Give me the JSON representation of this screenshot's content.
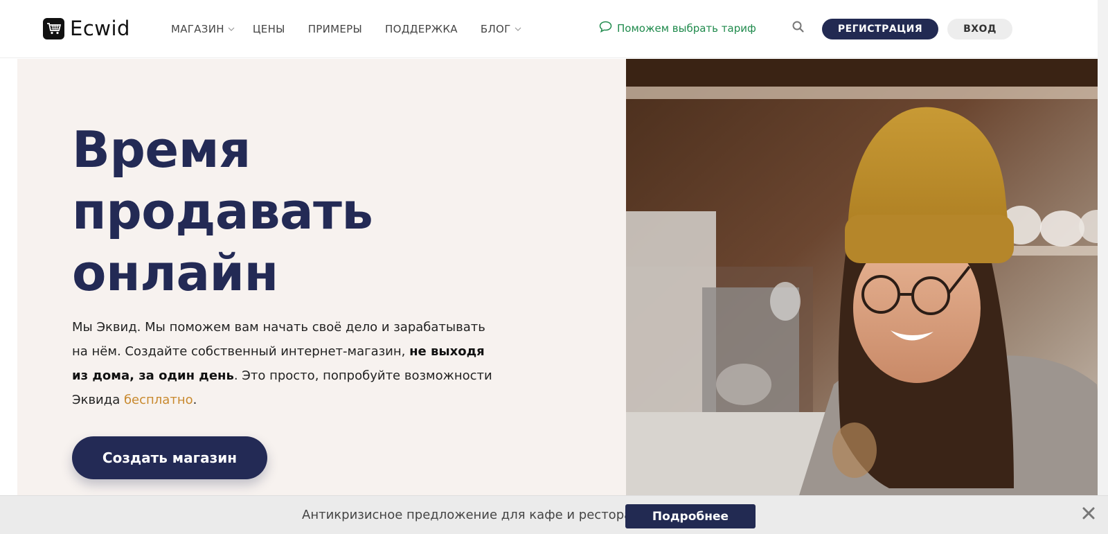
{
  "header": {
    "logo_text": "Ecwid",
    "nav": [
      {
        "label": "МАГАЗИН",
        "has_dropdown": true
      },
      {
        "label": "ЦЕНЫ",
        "has_dropdown": false
      },
      {
        "label": "ПРИМЕРЫ",
        "has_dropdown": false
      },
      {
        "label": "ПОДДЕРЖКА",
        "has_dropdown": false
      },
      {
        "label": "БЛОГ",
        "has_dropdown": true
      }
    ],
    "help_link": "Поможем выбрать тариф",
    "register_label": "РЕГИСТРАЦИЯ",
    "login_label": "ВХОД"
  },
  "hero": {
    "title": "Время\nпродавать\nонлайн",
    "text_part1": "Мы Эквид. Мы поможем вам начать своё дело и зарабатывать на нём. Создайте собственный интернет-магазин, ",
    "text_bold": "не выходя из дома, за один день",
    "text_part2": ". Это просто, попробуйте возможности Эквида ",
    "text_accent": "бесплатно",
    "text_end": ".",
    "cta_label": "Создать магазин"
  },
  "banner": {
    "text": "Антикризисное предложение для кафе и ресторанов",
    "button_label": "Подробнее"
  },
  "colors": {
    "brand_navy": "#232a55",
    "accent_gold": "#c8892e",
    "help_green": "#1f8a4c",
    "hero_bg": "#f7f2ef"
  },
  "icons": {
    "logo": "shopping-cart-icon",
    "help": "chat-bubble-icon",
    "search": "search-icon",
    "close": "close-icon",
    "dropdown": "chevron-down-icon"
  }
}
